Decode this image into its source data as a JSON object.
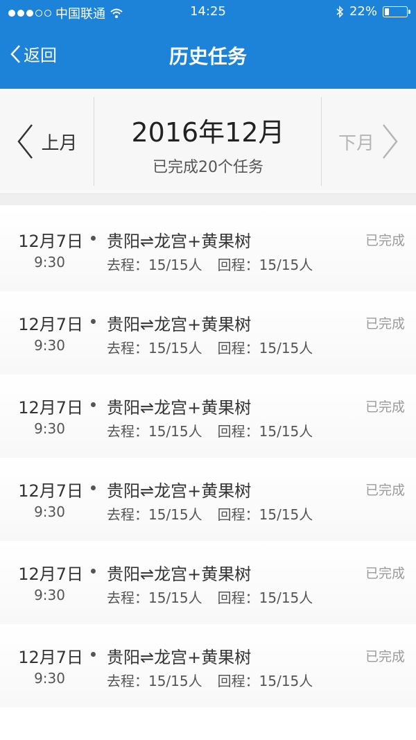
{
  "status_bar": {
    "carrier": "中国联通",
    "time": "14:25",
    "battery": "22%",
    "battery_level": 0.22,
    "icons": [
      "signal-dots",
      "wifi-icon",
      "bluetooth-icon",
      "battery-icon"
    ]
  },
  "nav": {
    "back_label": "返回",
    "title": "历史任务"
  },
  "month": {
    "prev_label": "上月",
    "current": "2016年12月",
    "summary": "已完成20个任务",
    "next_label": "下月"
  },
  "tasks": [
    {
      "date": "12月7日",
      "time": "9:30",
      "route": "贵阳⇌龙宫+黄果树",
      "outbound": "去程：15/15人",
      "return": "回程：15/15人",
      "status": "已完成"
    },
    {
      "date": "12月7日",
      "time": "9:30",
      "route": "贵阳⇌龙宫+黄果树",
      "outbound": "去程：15/15人",
      "return": "回程：15/15人",
      "status": "已完成"
    },
    {
      "date": "12月7日",
      "time": "9:30",
      "route": "贵阳⇌龙宫+黄果树",
      "outbound": "去程：15/15人",
      "return": "回程：15/15人",
      "status": "已完成"
    },
    {
      "date": "12月7日",
      "time": "9:30",
      "route": "贵阳⇌龙宫+黄果树",
      "outbound": "去程：15/15人",
      "return": "回程：15/15人",
      "status": "已完成"
    },
    {
      "date": "12月7日",
      "time": "9:30",
      "route": "贵阳⇌龙宫+黄果树",
      "outbound": "去程：15/15人",
      "return": "回程：15/15人",
      "status": "已完成"
    },
    {
      "date": "12月7日",
      "time": "9:30",
      "route": "贵阳⇌龙宫+黄果树",
      "outbound": "去程：15/15人",
      "return": "回程：15/15人",
      "status": "已完成"
    }
  ],
  "colors": {
    "header": "#1c83d8",
    "status_done": "#9a9a9a",
    "next_disabled": "#b5b5b5"
  }
}
